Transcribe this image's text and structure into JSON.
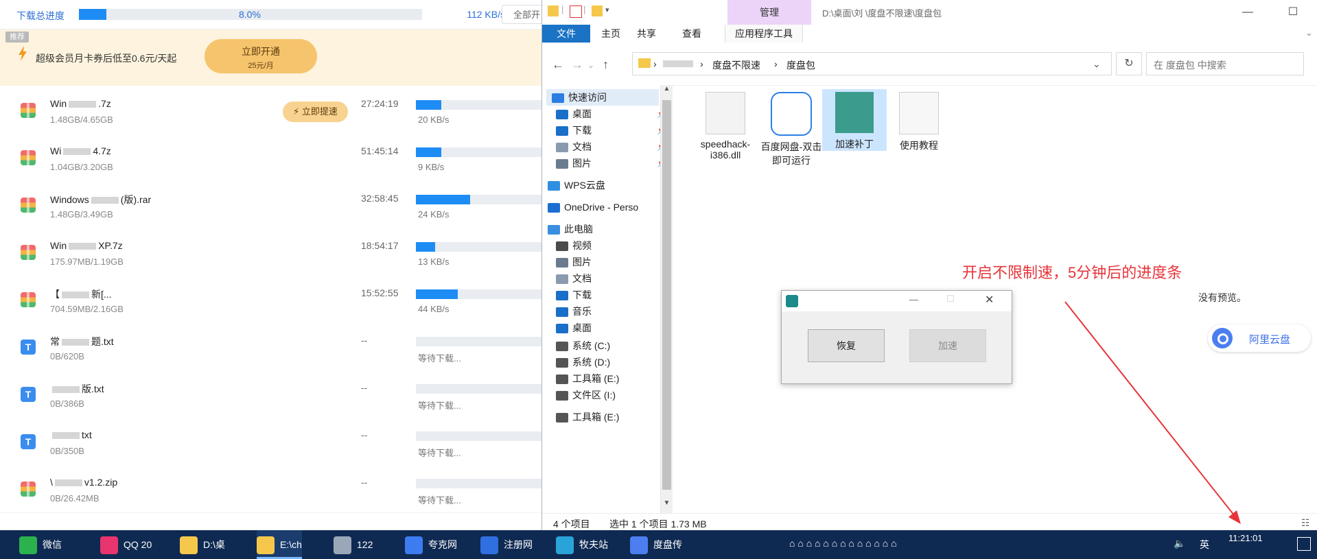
{
  "download_manager": {
    "total_label": "下载总进度",
    "total_percent": "8.0%",
    "total_fraction": 0.08,
    "total_speed": "112 KB/s",
    "all_button": "全部开",
    "promo": {
      "tag": "推荐",
      "text": "超级会员月卡券后低至0.6元/天起",
      "button_main": "立即开通",
      "button_sub": "25元/月"
    },
    "boost_label": "立即提速",
    "items": [
      {
        "icon": "zip",
        "name_head": "Win",
        "name_tail": ".7z",
        "size": "1.48GB/4.65GB",
        "time": "27:24:19",
        "progress": 0.2,
        "rate": "20 KB/s",
        "boost": true
      },
      {
        "icon": "zip",
        "name_head": "Wi",
        "name_tail": "4.7z",
        "size": "1.04GB/3.20GB",
        "time": "51:45:14",
        "progress": 0.2,
        "rate": "9 KB/s",
        "boost": false
      },
      {
        "icon": "zip",
        "name_head": "Windows",
        "name_tail": "(版).rar",
        "size": "1.48GB/3.49GB",
        "time": "32:58:45",
        "progress": 0.43,
        "rate": "24 KB/s",
        "boost": false
      },
      {
        "icon": "zip",
        "name_head": "Win",
        "name_tail": "XP.7z",
        "size": "175.97MB/1.19GB",
        "time": "18:54:17",
        "progress": 0.15,
        "rate": "13 KB/s",
        "boost": false
      },
      {
        "icon": "zip",
        "name_head": "【",
        "name_tail": "新[...",
        "size": "704.59MB/2.16GB",
        "time": "15:52:55",
        "progress": 0.33,
        "rate": "44 KB/s",
        "boost": false
      },
      {
        "icon": "txt",
        "name_head": "常",
        "name_tail": "题.txt",
        "size": "0B/620B",
        "time": "--",
        "progress": 0,
        "rate": "等待下载...",
        "boost": false
      },
      {
        "icon": "txt",
        "name_head": "",
        "name_tail": "版.txt",
        "size": "0B/386B",
        "time": "--",
        "progress": 0,
        "rate": "等待下载...",
        "boost": false
      },
      {
        "icon": "txt",
        "name_head": "",
        "name_tail": "txt",
        "size": "0B/350B",
        "time": "--",
        "progress": 0,
        "rate": "等待下载...",
        "boost": false
      },
      {
        "icon": "zip",
        "name_head": "\\",
        "name_tail": "v1.2.zip",
        "size": "0B/26.42MB",
        "time": "--",
        "progress": 0,
        "rate": "等待下载...",
        "boost": false
      }
    ]
  },
  "explorer": {
    "title_manage": "管理",
    "title_path": "D:\\桌面\\刘  \\度盘不限速\\度盘包",
    "ribbon_tabs": [
      "文件",
      "主页",
      "共享",
      "查看",
      "应用程序工具"
    ],
    "crumbs": [
      "度盘不限速",
      "度盘包"
    ],
    "search_placeholder": "在 度盘包 中搜索",
    "nav_items": [
      {
        "label": "快速访问",
        "icon": "star-icon",
        "color": "#2b7de1",
        "pin": false
      },
      {
        "label": "桌面",
        "icon": "desktop-icon",
        "color": "#1a6fc8",
        "pin": true
      },
      {
        "label": "下载",
        "icon": "download-icon",
        "color": "#1a6fc8",
        "pin": true
      },
      {
        "label": "文档",
        "icon": "document-icon",
        "color": "#8a9bb0",
        "pin": true
      },
      {
        "label": "图片",
        "icon": "picture-icon",
        "color": "#6b7b8f",
        "pin": true
      },
      {
        "label": "WPS云盘",
        "icon": "cloud-icon",
        "color": "#2f8fe0",
        "pin": false
      },
      {
        "label": "OneDrive - Perso",
        "icon": "onedrive-icon",
        "color": "#1c6fd1",
        "pin": false
      },
      {
        "label": "此电脑",
        "icon": "computer-icon",
        "color": "#3a8ee0",
        "pin": false
      },
      {
        "label": "视频",
        "icon": "video-icon",
        "color": "#4b4b4b",
        "pin": false
      },
      {
        "label": "图片",
        "icon": "picture-icon",
        "color": "#6b7b8f",
        "pin": false
      },
      {
        "label": "文档",
        "icon": "document-icon",
        "color": "#8a9bb0",
        "pin": false
      },
      {
        "label": "下载",
        "icon": "download-icon",
        "color": "#1a6fc8",
        "pin": false
      },
      {
        "label": "音乐",
        "icon": "music-icon",
        "color": "#1a6fc8",
        "pin": false
      },
      {
        "label": "桌面",
        "icon": "desktop-icon",
        "color": "#1a6fc8",
        "pin": false
      },
      {
        "label": "系统 (C:)",
        "icon": "drive-icon",
        "color": "#555",
        "pin": false
      },
      {
        "label": "系统 (D:)",
        "icon": "drive-icon",
        "color": "#555",
        "pin": false
      },
      {
        "label": "工具箱 (E:)",
        "icon": "drive-icon",
        "color": "#555",
        "pin": false
      },
      {
        "label": "文件区 (I:)",
        "icon": "drive-icon",
        "color": "#555",
        "pin": false
      },
      {
        "label": "工具箱 (E:)",
        "icon": "drive-icon",
        "color": "#555",
        "pin": false
      }
    ],
    "files": [
      {
        "name": "speedhack-i386.dll",
        "icon": "dll-file-icon",
        "selected": false
      },
      {
        "name": "百度网盘-双击即可运行",
        "icon": "baidu-netdisk-icon",
        "selected": false
      },
      {
        "name": "加速补丁",
        "icon": "patch-app-icon",
        "selected": true
      },
      {
        "name": "使用教程",
        "icon": "text-file-icon",
        "selected": false
      }
    ],
    "status_count": "4 个项目",
    "status_selected": "选中 1 个项目  1.73 MB",
    "no_preview": "没有预览。",
    "aliyun_label": "阿里云盘"
  },
  "dialog": {
    "restore_label": "恢复",
    "speedup_label": "加速"
  },
  "annotation": "开启不限制速，5分钟后的进度条",
  "taskbar": {
    "items": [
      {
        "label": "微信",
        "color": "#2bb24c"
      },
      {
        "label": "QQ 20",
        "color": "#e8346f"
      },
      {
        "label": "D:\\桌",
        "color": "#f5c84c"
      },
      {
        "label": "E:\\ch",
        "color": "#f5c84c"
      },
      {
        "label": "122",
        "color": "#9aa7b8"
      },
      {
        "label": "夸克网",
        "color": "#3d7bf0"
      },
      {
        "label": "注册网",
        "color": "#2f6fe0"
      },
      {
        "label": "牧夫站",
        "color": "#2aa3d8"
      },
      {
        "label": "度盘传",
        "color": "#4c7ef0"
      }
    ],
    "time": "11:21:01",
    "ime": "英"
  },
  "colors": {
    "accent": "#1e8cf5",
    "promo_bg": "#fdf3de",
    "annotation_red": "#e8333a",
    "taskbar": "#0f2a52"
  }
}
